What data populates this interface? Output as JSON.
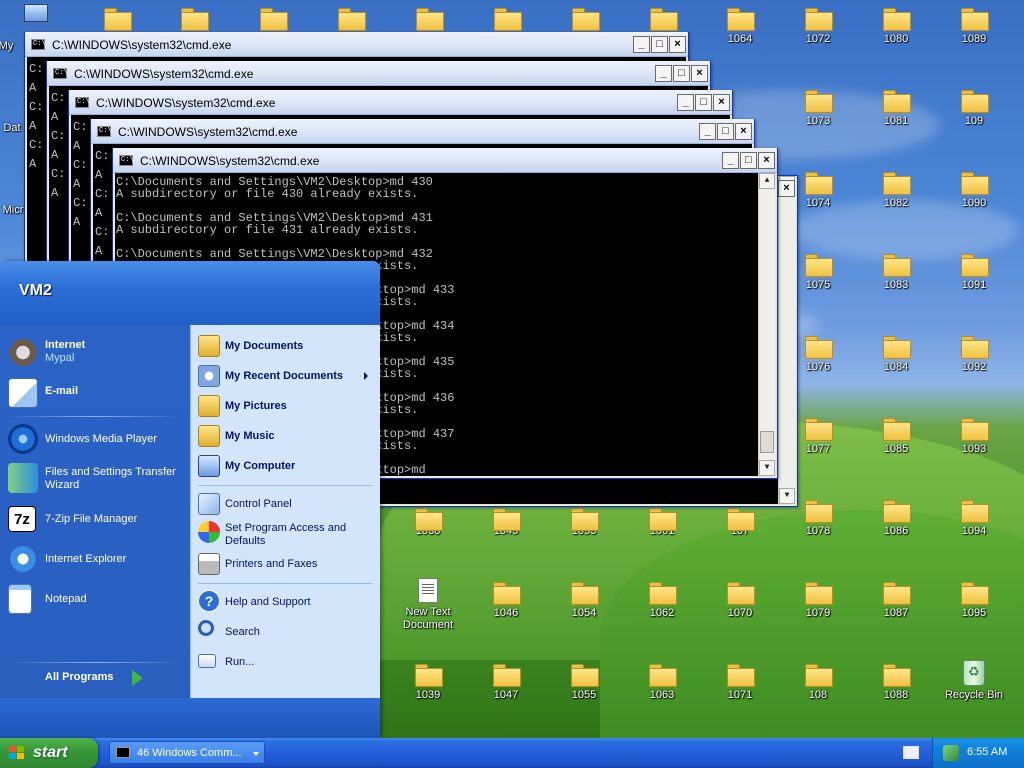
{
  "desktop_icons": {
    "top_row_left_label": "My",
    "left_label_2": "Dat",
    "left_label_3": "Micr",
    "col_1064": "1064",
    "col_1072": "1072",
    "col_1080": "1080",
    "col_1089": "1089",
    "col_1073": "1073",
    "col_1081": "1081",
    "col_109": "109",
    "col_1074": "1074",
    "col_1082": "1082",
    "col_1090": "1090",
    "col_1075": "1075",
    "col_1083": "1083",
    "col_1091": "1091",
    "col_1076": "1076",
    "col_1084": "1084",
    "col_1092": "1092",
    "col_1077": "1077",
    "col_1085": "1085",
    "col_1093": "1093",
    "row_1038": "1038",
    "row_1045": "1045",
    "row_1053": "1053",
    "row_1061": "1061",
    "row_107": "107",
    "col_1078": "1078",
    "col_1086": "1086",
    "col_1094": "1094",
    "new_text_doc": "New Text Document",
    "row_1046": "1046",
    "row_1054": "1054",
    "row_1062": "1062",
    "row_1070": "1070",
    "col_1079": "1079",
    "col_1087": "1087",
    "col_1095": "1095",
    "row_1039": "1039",
    "row_1047": "1047",
    "row_1055": "1055",
    "row_1063": "1063",
    "row_1071": "1071",
    "col_108": "108",
    "col_1088": "1088",
    "recycle_bin": "Recycle Bin"
  },
  "cmd": {
    "title": "C:\\WINDOWS\\system32\\cmd.exe",
    "left_col_glyphs": [
      "C:",
      "A",
      "C:",
      "A",
      "C:",
      "A",
      "C:",
      "A",
      "C:",
      "A",
      "C:",
      "A"
    ],
    "front_lines": [
      "C:\\Documents and Settings\\VM2\\Desktop>md 430",
      "A subdirectory or file 430 already exists.",
      "",
      "C:\\Documents and Settings\\VM2\\Desktop>md 431",
      "A subdirectory or file 431 already exists.",
      "",
      "C:\\Documents and Settings\\VM2\\Desktop>md 432",
      "                                 y exists.",
      "",
      "                                 Desktop>md 433",
      "                                 y exists.",
      "",
      "                                 Desktop>md 434",
      "                                 y exists.",
      "",
      "                                 Desktop>md 435",
      "                                 y exists.",
      "",
      "                                 Desktop>md 436",
      "                                 y exists.",
      "",
      "                                 Desktop>md 437",
      "                                 y exists.",
      "",
      "                                 Desktop>md"
    ]
  },
  "start_menu": {
    "user": "VM2",
    "pinned": [
      {
        "label": "Internet",
        "sub": "Mypal"
      },
      {
        "label": "E-mail",
        "sub": ""
      }
    ],
    "recent": [
      {
        "label": "Windows Media Player"
      },
      {
        "label": "Files and Settings Transfer",
        "label2": "Wizard"
      },
      {
        "label": "7-Zip File Manager"
      },
      {
        "label": "Internet Explorer"
      },
      {
        "label": "Notepad"
      }
    ],
    "all_programs": "All Programs",
    "right": [
      {
        "label": "My Documents"
      },
      {
        "label": "My Recent Documents"
      },
      {
        "label": "My Pictures"
      },
      {
        "label": "My Music"
      },
      {
        "label": "My Computer"
      },
      {
        "label": "Control Panel"
      },
      {
        "label": "Set Program Access and",
        "label2": "Defaults"
      },
      {
        "label": "Printers and Faxes"
      },
      {
        "label": "Help and Support"
      },
      {
        "label": "Search"
      },
      {
        "label": "Run..."
      }
    ],
    "icon_7zip": "7z"
  },
  "taskbar": {
    "start_label": "start",
    "task_button": "46 Windows Comm...",
    "clock": "6:55 AM"
  }
}
